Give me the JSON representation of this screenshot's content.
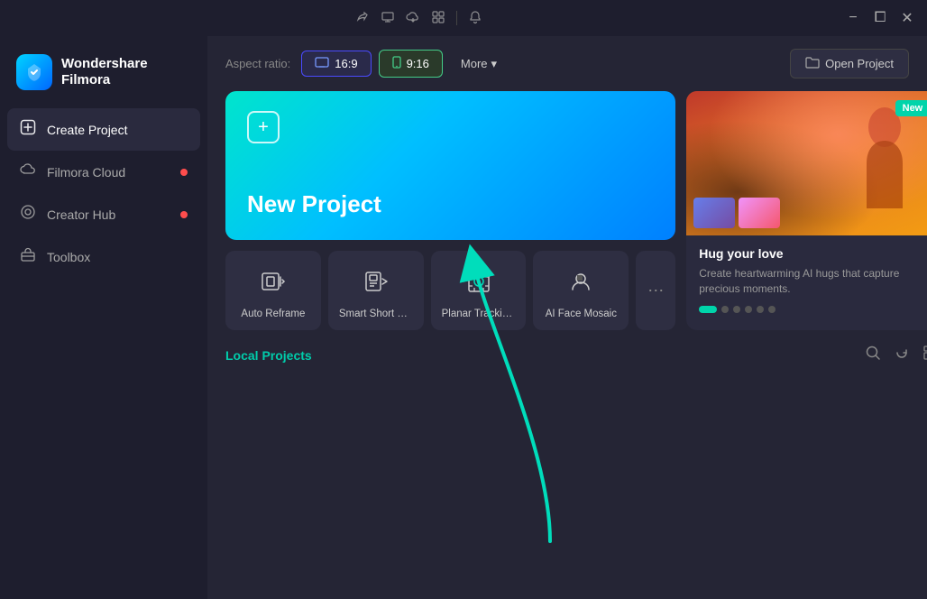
{
  "titlebar": {
    "icons": [
      {
        "name": "share-icon",
        "symbol": "⊹"
      },
      {
        "name": "screen-icon",
        "symbol": "⊡"
      },
      {
        "name": "cloud-icon",
        "symbol": "☁"
      },
      {
        "name": "grid-icon",
        "symbol": "⊞"
      },
      {
        "name": "bell-icon",
        "symbol": "🔔"
      }
    ],
    "min_label": "−",
    "max_label": "⧠",
    "close_label": "✕"
  },
  "sidebar": {
    "logo_line1": "Wondershare",
    "logo_line2": "Filmora",
    "nav_items": [
      {
        "id": "create-project",
        "label": "Create Project",
        "icon": "➕",
        "active": true,
        "badge": false
      },
      {
        "id": "filmora-cloud",
        "label": "Filmora Cloud",
        "icon": "☁",
        "active": false,
        "badge": true
      },
      {
        "id": "creator-hub",
        "label": "Creator Hub",
        "icon": "◎",
        "active": false,
        "badge": true
      },
      {
        "id": "toolbox",
        "label": "Toolbox",
        "icon": "⊡",
        "active": false,
        "badge": false
      }
    ]
  },
  "toolbar": {
    "aspect_ratio_label": "Aspect ratio:",
    "btn_16_9": "16:9",
    "btn_9_16": "9:16",
    "more_label": "More",
    "open_project_label": "Open Project"
  },
  "new_project": {
    "title": "New Project"
  },
  "feature_cards": [
    {
      "id": "auto-reframe",
      "label": "Auto Reframe",
      "icon": "⧉"
    },
    {
      "id": "smart-short-clip",
      "label": "Smart Short Cli...",
      "icon": "⊟"
    },
    {
      "id": "planar-tracking",
      "label": "Planar Tracking...",
      "icon": "◈"
    },
    {
      "id": "ai-face-mosaic",
      "label": "AI Face Mosaic",
      "icon": "◉"
    }
  ],
  "feature_more": "⋯",
  "right_panel": {
    "badge": "New",
    "title": "Hug your love",
    "description": "Create heartwarming AI hugs that capture precious moments.",
    "dots": [
      true,
      false,
      false,
      false,
      false,
      false
    ]
  },
  "local_projects": {
    "title": "Local Projects"
  }
}
